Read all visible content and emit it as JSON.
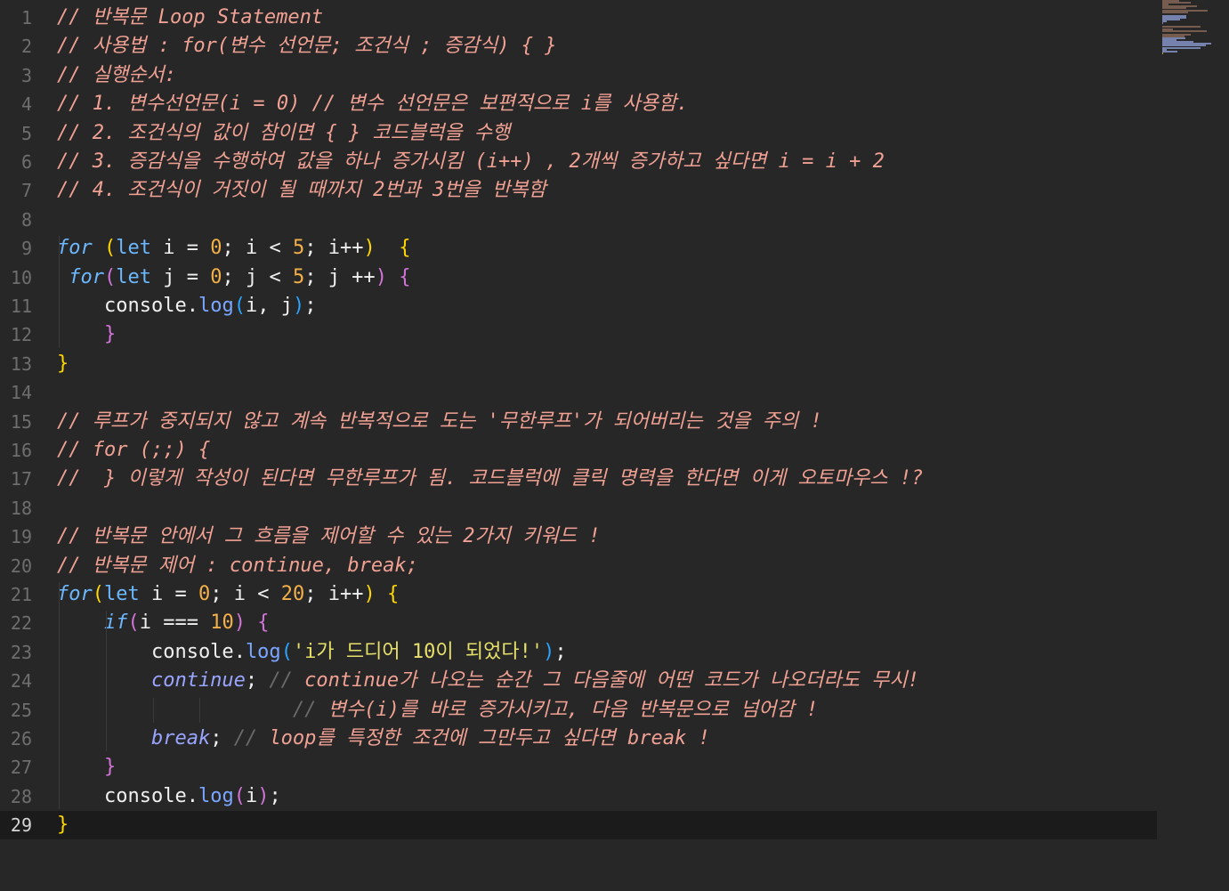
{
  "editor": {
    "current_line": 29,
    "lines": [
      {
        "n": "1",
        "tokens": [
          {
            "t": "// 반복문 Loop Statement",
            "c": "c"
          }
        ]
      },
      {
        "n": "2",
        "tokens": [
          {
            "t": "// 사용법 : for(변수 선언문; 조건식 ; 증감식) { }",
            "c": "c"
          }
        ]
      },
      {
        "n": "3",
        "tokens": [
          {
            "t": "// 실행순서:",
            "c": "c"
          }
        ]
      },
      {
        "n": "4",
        "tokens": [
          {
            "t": "// 1. 변수선언문(i = 0) // 변수 선언문은 보편적으로 i를 사용함.",
            "c": "c"
          }
        ]
      },
      {
        "n": "5",
        "tokens": [
          {
            "t": "// 2. 조건식의 값이 참이면 { } 코드블럭을 수행",
            "c": "c"
          }
        ]
      },
      {
        "n": "6",
        "tokens": [
          {
            "t": "// 3. 증감식을 수행하여 값을 하나 증가시킴 (i++) , 2개씩 증가하고 싶다면 i = i + 2",
            "c": "c"
          }
        ]
      },
      {
        "n": "7",
        "tokens": [
          {
            "t": "// 4. 조건식이 거짓이 될 때까지 2번과 3번을 반복함",
            "c": "c"
          }
        ]
      },
      {
        "n": "8",
        "tokens": []
      },
      {
        "n": "9",
        "tokens": [
          {
            "t": "for",
            "c": "kw"
          },
          {
            "t": " ",
            "c": "tx"
          },
          {
            "t": "(",
            "c": "p1"
          },
          {
            "t": "let",
            "c": "ty"
          },
          {
            "t": " i = ",
            "c": "tx"
          },
          {
            "t": "0",
            "c": "num"
          },
          {
            "t": "; i < ",
            "c": "tx"
          },
          {
            "t": "5",
            "c": "num"
          },
          {
            "t": "; i++",
            "c": "tx"
          },
          {
            "t": ")",
            "c": "p1"
          },
          {
            "t": "  ",
            "c": "tx"
          },
          {
            "t": "{",
            "c": "p1"
          }
        ]
      },
      {
        "n": "10",
        "tokens": [
          {
            "t": " for",
            "c": "kw"
          },
          {
            "t": "(",
            "c": "p2"
          },
          {
            "t": "let",
            "c": "ty"
          },
          {
            "t": " j = ",
            "c": "tx"
          },
          {
            "t": "0",
            "c": "num"
          },
          {
            "t": "; j < ",
            "c": "tx"
          },
          {
            "t": "5",
            "c": "num"
          },
          {
            "t": "; j ++",
            "c": "tx"
          },
          {
            "t": ")",
            "c": "p2"
          },
          {
            "t": " ",
            "c": "tx"
          },
          {
            "t": "{",
            "c": "p2"
          }
        ]
      },
      {
        "n": "11",
        "tokens": [
          {
            "t": "    console",
            "c": "tx"
          },
          {
            "t": ".",
            "c": "tx"
          },
          {
            "t": "log",
            "c": "fn"
          },
          {
            "t": "(",
            "c": "p3"
          },
          {
            "t": "i, j",
            "c": "tx"
          },
          {
            "t": ")",
            "c": "p3"
          },
          {
            "t": ";",
            "c": "tx"
          }
        ]
      },
      {
        "n": "12",
        "tokens": [
          {
            "t": "    ",
            "c": "tx"
          },
          {
            "t": "}",
            "c": "p2"
          }
        ]
      },
      {
        "n": "13",
        "tokens": [
          {
            "t": "}",
            "c": "p1"
          }
        ]
      },
      {
        "n": "14",
        "tokens": []
      },
      {
        "n": "15",
        "tokens": [
          {
            "t": "// 루프가 중지되지 않고 계속 반복적으로 도는 '무한루프'가 되어버리는 것을 주의 !",
            "c": "c"
          }
        ]
      },
      {
        "n": "16",
        "tokens": [
          {
            "t": "// for (;;) {",
            "c": "c"
          }
        ]
      },
      {
        "n": "17",
        "tokens": [
          {
            "t": "//  } 이렇게 작성이 된다면 무한루프가 됨. 코드블럭에 클릭 명력을 한다면 이게 오토마우스 !?",
            "c": "c"
          }
        ]
      },
      {
        "n": "18",
        "tokens": []
      },
      {
        "n": "19",
        "tokens": [
          {
            "t": "// 반복문 안에서 그 흐름을 제어할 수 있는 2가지 키워드 !",
            "c": "c"
          }
        ]
      },
      {
        "n": "20",
        "tokens": [
          {
            "t": "// 반복문 제어 : continue, break;",
            "c": "c"
          }
        ]
      },
      {
        "n": "21",
        "tokens": [
          {
            "t": "for",
            "c": "kw"
          },
          {
            "t": "(",
            "c": "p1"
          },
          {
            "t": "let",
            "c": "ty"
          },
          {
            "t": " i = ",
            "c": "tx"
          },
          {
            "t": "0",
            "c": "num"
          },
          {
            "t": "; i < ",
            "c": "tx"
          },
          {
            "t": "20",
            "c": "num"
          },
          {
            "t": "; i++",
            "c": "tx"
          },
          {
            "t": ")",
            "c": "p1"
          },
          {
            "t": " ",
            "c": "tx"
          },
          {
            "t": "{",
            "c": "p1"
          }
        ]
      },
      {
        "n": "22",
        "tokens": [
          {
            "t": "    if",
            "c": "kw"
          },
          {
            "t": "(",
            "c": "p2"
          },
          {
            "t": "i === ",
            "c": "tx"
          },
          {
            "t": "10",
            "c": "num"
          },
          {
            "t": ")",
            "c": "p2"
          },
          {
            "t": " ",
            "c": "tx"
          },
          {
            "t": "{",
            "c": "p2"
          }
        ]
      },
      {
        "n": "23",
        "tokens": [
          {
            "t": "        console",
            "c": "tx"
          },
          {
            "t": ".",
            "c": "tx"
          },
          {
            "t": "log",
            "c": "fn"
          },
          {
            "t": "(",
            "c": "p3"
          },
          {
            "t": "'i가 드디어 10이 되었다!'",
            "c": "str"
          },
          {
            "t": ")",
            "c": "p3"
          },
          {
            "t": ";",
            "c": "tx"
          }
        ]
      },
      {
        "n": "24",
        "tokens": [
          {
            "t": "        continue",
            "c": "kw2"
          },
          {
            "t": "; ",
            "c": "tx"
          },
          {
            "t": "// ",
            "c": "cs"
          },
          {
            "t": "continue가 나오는 순간 그 다음줄에 어떤 코드가 나오더라도 무시!",
            "c": "c"
          }
        ]
      },
      {
        "n": "25",
        "tokens": [
          {
            "t": "                    ",
            "c": "tx"
          },
          {
            "t": "// ",
            "c": "cs"
          },
          {
            "t": "변수(i)를 바로 증가시키고, 다음 반복문으로 넘어감 !",
            "c": "c"
          }
        ]
      },
      {
        "n": "26",
        "tokens": [
          {
            "t": "        break",
            "c": "kw2"
          },
          {
            "t": "; ",
            "c": "tx"
          },
          {
            "t": "// ",
            "c": "cs"
          },
          {
            "t": "loop를 특정한 조건에 그만두고 싶다면 break !",
            "c": "c"
          }
        ]
      },
      {
        "n": "27",
        "tokens": [
          {
            "t": "    ",
            "c": "tx"
          },
          {
            "t": "}",
            "c": "p2"
          }
        ]
      },
      {
        "n": "28",
        "tokens": [
          {
            "t": "    console",
            "c": "tx"
          },
          {
            "t": ".",
            "c": "tx"
          },
          {
            "t": "log",
            "c": "fn"
          },
          {
            "t": "(",
            "c": "p2"
          },
          {
            "t": "i",
            "c": "tx"
          },
          {
            "t": ")",
            "c": "p2"
          },
          {
            "t": ";",
            "c": "tx"
          }
        ]
      },
      {
        "n": "29",
        "tokens": [
          {
            "t": "}",
            "c": "p1"
          }
        ]
      }
    ]
  }
}
